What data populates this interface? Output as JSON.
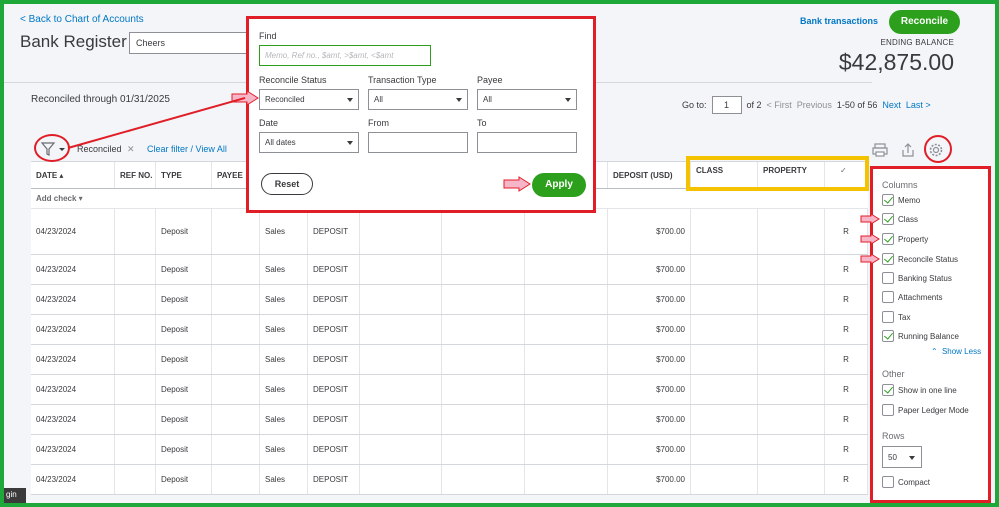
{
  "header": {
    "back_link": "< Back to Chart of Accounts",
    "title": "Bank Register",
    "account": "Cheers",
    "bank_transactions": "Bank transactions",
    "reconcile": "Reconcile",
    "ending_balance_label": "ENDING BALANCE",
    "ending_balance": "$42,875.00"
  },
  "reconciled_through": "Reconciled through 01/31/2025",
  "pager": {
    "go_to": "Go to:",
    "page": "1",
    "of": "of 2",
    "first": "< First",
    "previous": "Previous",
    "range": "1-50 of 56",
    "next": "Next",
    "last": "Last >"
  },
  "filter": {
    "chip": "Reconciled",
    "chip_close": "✕",
    "clear": "Clear filter / View All"
  },
  "table": {
    "headers": [
      "DATE ▴",
      "REF NO.",
      "TYPE",
      "PAYEE",
      "",
      "",
      "",
      "",
      "D)",
      "DEPOSIT (USD)",
      "CLASS",
      "PROPERTY",
      "✓"
    ],
    "add_check": "Add check ▾",
    "rows": [
      {
        "date": "04/23/2024",
        "type": "Deposit",
        "account": "Sales",
        "memo": "DEPOSIT",
        "deposit": "$700.00",
        "status": "R"
      },
      {
        "date": "04/23/2024",
        "type": "Deposit",
        "account": "Sales",
        "memo": "DEPOSIT",
        "deposit": "$700.00",
        "status": "R"
      },
      {
        "date": "04/23/2024",
        "type": "Deposit",
        "account": "Sales",
        "memo": "DEPOSIT",
        "deposit": "$700.00",
        "status": "R"
      },
      {
        "date": "04/23/2024",
        "type": "Deposit",
        "account": "Sales",
        "memo": "DEPOSIT",
        "deposit": "$700.00",
        "status": "R"
      },
      {
        "date": "04/23/2024",
        "type": "Deposit",
        "account": "Sales",
        "memo": "DEPOSIT",
        "deposit": "$700.00",
        "status": "R"
      },
      {
        "date": "04/23/2024",
        "type": "Deposit",
        "account": "Sales",
        "memo": "DEPOSIT",
        "deposit": "$700.00",
        "status": "R"
      },
      {
        "date": "04/23/2024",
        "type": "Deposit",
        "account": "Sales",
        "memo": "DEPOSIT",
        "deposit": "$700.00",
        "status": "R"
      },
      {
        "date": "04/23/2024",
        "type": "Deposit",
        "account": "Sales",
        "memo": "DEPOSIT",
        "deposit": "$700.00",
        "status": "R"
      },
      {
        "date": "04/23/2024",
        "type": "Deposit",
        "account": "Sales",
        "memo": "DEPOSIT",
        "deposit": "$700.00",
        "status": "R"
      }
    ]
  },
  "find_popover": {
    "find_label": "Find",
    "find_placeholder": "Memo, Ref no., $amt, >$amt, <$amt",
    "reconcile_status_label": "Reconcile Status",
    "reconcile_status": "Reconciled",
    "transaction_type_label": "Transaction Type",
    "transaction_type": "All",
    "payee_label": "Payee",
    "payee": "All",
    "date_label": "Date",
    "date": "All dates",
    "from_label": "From",
    "from": "",
    "to_label": "To",
    "to": "",
    "reset": "Reset",
    "apply": "Apply"
  },
  "settings": {
    "columns_head": "Columns",
    "columns": [
      {
        "label": "Memo",
        "checked": true
      },
      {
        "label": "Class",
        "checked": true
      },
      {
        "label": "Property",
        "checked": true
      },
      {
        "label": "Reconcile Status",
        "checked": true
      },
      {
        "label": "Banking Status",
        "checked": false
      },
      {
        "label": "Attachments",
        "checked": false
      },
      {
        "label": "Tax",
        "checked": false
      },
      {
        "label": "Running Balance",
        "checked": true
      }
    ],
    "show_less": "Show Less",
    "other_head": "Other",
    "other": [
      {
        "label": "Show in one line",
        "checked": true
      },
      {
        "label": "Paper Ledger Mode",
        "checked": false
      }
    ],
    "rows_head": "Rows",
    "rows_value": "50",
    "compact": "Compact"
  },
  "login_tab": "gin",
  "colors": {
    "brand_green": "#2ca01c",
    "link_blue": "#0077c5",
    "annotation_red": "#e01e28",
    "annotation_yellow": "#f5c200",
    "outer_border_green": "#1fa83a"
  }
}
